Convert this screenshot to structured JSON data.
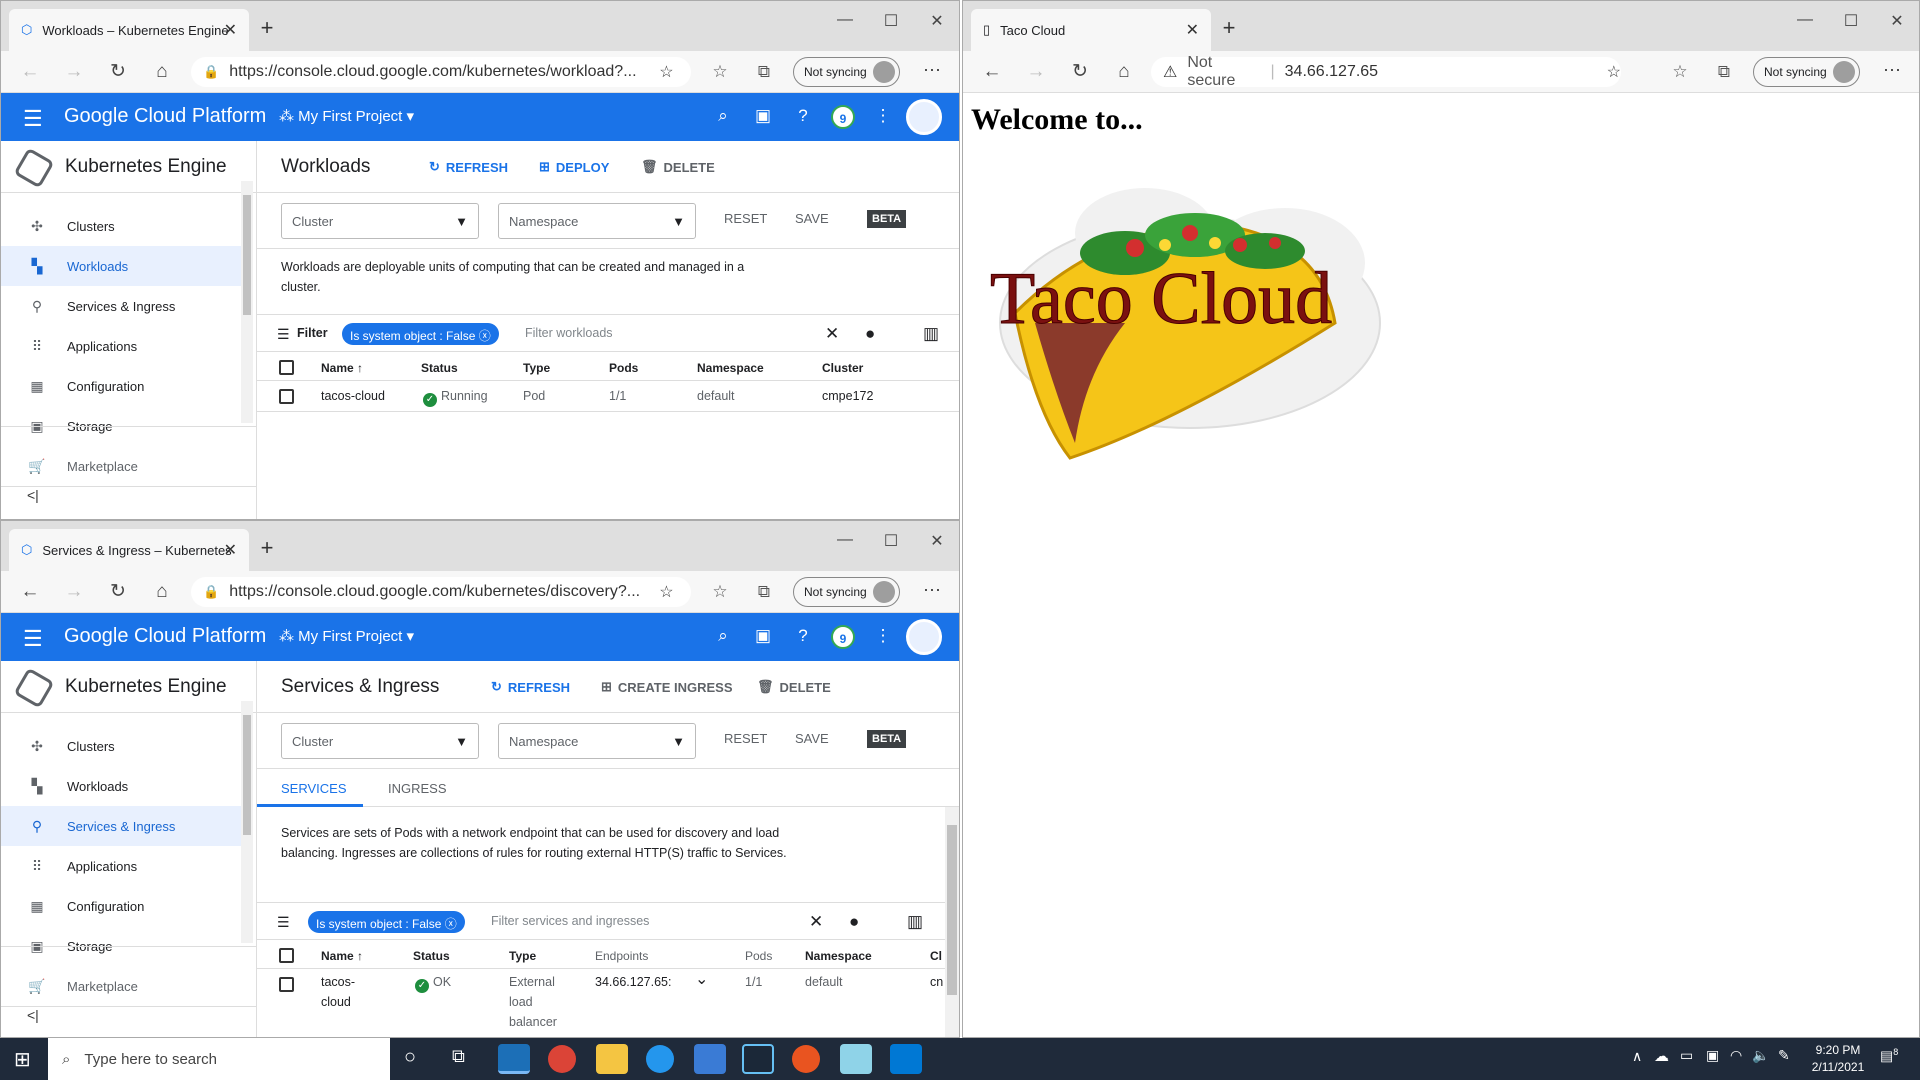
{
  "top_window": {
    "tab_title": "Workloads – Kubernetes Engine",
    "url": "https://console.cloud.google.com/kubernetes/workload?...",
    "sync_label": "Not syncing",
    "gcp": {
      "brand": "Google Cloud Platform",
      "project": "My First Project",
      "notification_count": "9"
    },
    "product_title": "Kubernetes Engine",
    "sidebar": [
      "Clusters",
      "Workloads",
      "Services & Ingress",
      "Applications",
      "Configuration",
      "Storage",
      "Marketplace"
    ],
    "page_title": "Workloads",
    "actions": {
      "refresh": "REFRESH",
      "deploy": "DEPLOY",
      "delete": "DELETE"
    },
    "filters": {
      "cluster": "Cluster",
      "namespace": "Namespace",
      "reset": "RESET",
      "save": "SAVE",
      "beta": "BETA"
    },
    "description": "Workloads are deployable units of computing that can be created and managed in a cluster.",
    "filter_label": "Filter",
    "chip": "Is system object : False",
    "filter_placeholder": "Filter workloads",
    "columns": [
      "Name",
      "Status",
      "Type",
      "Pods",
      "Namespace",
      "Cluster"
    ],
    "rows": [
      {
        "name": "tacos-cloud",
        "status": "Running",
        "type": "Pod",
        "pods": "1/1",
        "namespace": "default",
        "cluster": "cmpe172"
      }
    ]
  },
  "bottom_window": {
    "tab_title": "Services & Ingress – Kubernetes",
    "url": "https://console.cloud.google.com/kubernetes/discovery?...",
    "sync_label": "Not syncing",
    "gcp": {
      "brand": "Google Cloud Platform",
      "project": "My First Project",
      "notification_count": "9"
    },
    "product_title": "Kubernetes Engine",
    "sidebar": [
      "Clusters",
      "Workloads",
      "Services & Ingress",
      "Applications",
      "Configuration",
      "Storage",
      "Marketplace"
    ],
    "page_title": "Services & Ingress",
    "actions": {
      "refresh": "REFRESH",
      "create": "CREATE INGRESS",
      "delete": "DELETE"
    },
    "filters": {
      "cluster": "Cluster",
      "namespace": "Namespace",
      "reset": "RESET",
      "save": "SAVE",
      "beta": "BETA"
    },
    "tabs": [
      "SERVICES",
      "INGRESS"
    ],
    "description": "Services are sets of Pods with a network endpoint that can be used for discovery and load balancing. Ingresses are collections of rules for routing external HTTP(S) traffic to Services.",
    "chip": "Is system object : False",
    "filter_placeholder": "Filter services and ingresses",
    "columns": [
      "Name",
      "Status",
      "Type",
      "Endpoints",
      "Pods",
      "Namespace",
      "Cl"
    ],
    "rows": [
      {
        "name": "tacos-cloud",
        "status": "OK",
        "type": "External load balancer",
        "endpoints": "34.66.127.65:",
        "pods": "1/1",
        "namespace": "default",
        "cluster": "cn"
      }
    ]
  },
  "right_window": {
    "tab_title": "Taco Cloud",
    "not_secure": "Not secure",
    "url": "34.66.127.65",
    "sync_label": "Not syncing",
    "heading": "Welcome to...",
    "logo_text": "Taco Cloud"
  },
  "taskbar": {
    "search_placeholder": "Type here to search",
    "time": "9:20 PM",
    "date": "2/11/2021",
    "notifications": "8"
  }
}
